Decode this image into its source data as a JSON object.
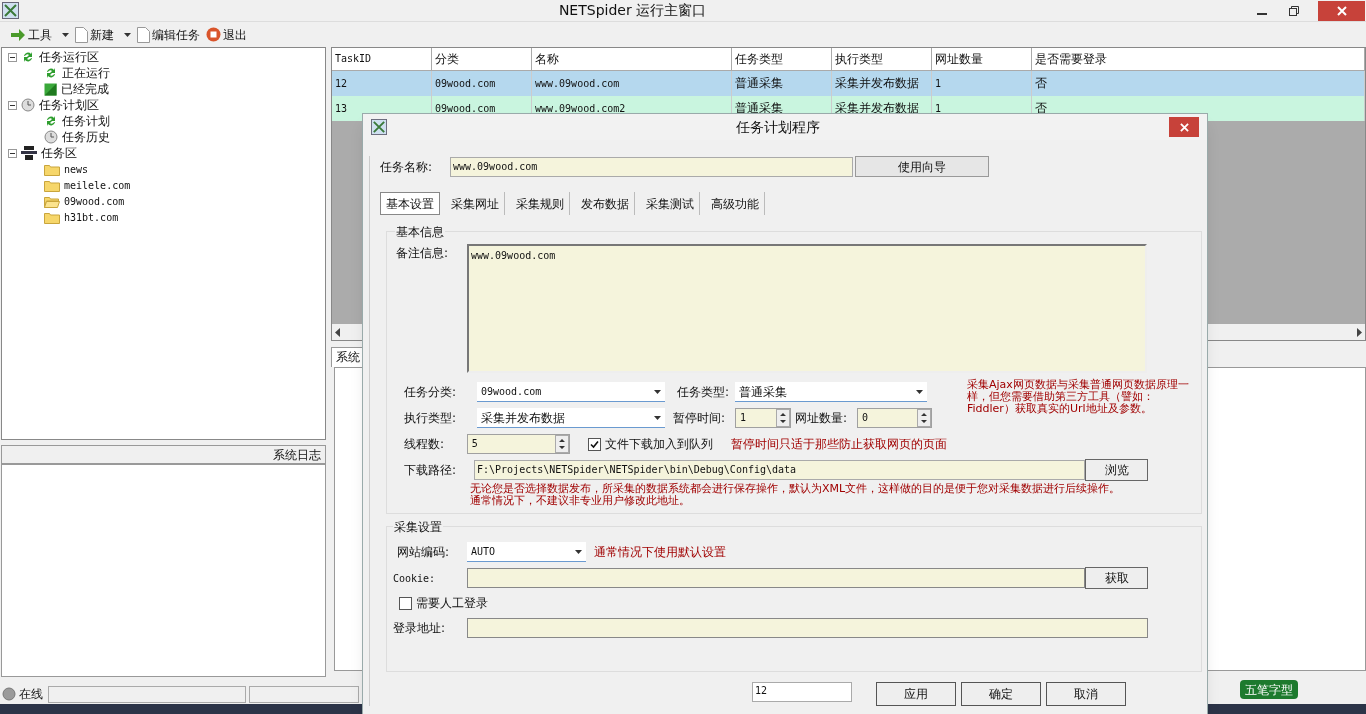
{
  "window": {
    "title": "NETSpider 运行主窗口"
  },
  "toolbar": [
    {
      "label": "工具",
      "kind": "dropdown"
    },
    {
      "label": "新建",
      "kind": "dropdown"
    },
    {
      "label": "编辑任务",
      "kind": "plain"
    },
    {
      "label": "退出",
      "kind": "plain"
    }
  ],
  "tree": [
    {
      "label": "任务运行区",
      "expanded": true,
      "children": [
        {
          "label": "正在运行"
        },
        {
          "label": "已经完成"
        }
      ]
    },
    {
      "label": "任务计划区",
      "expanded": true,
      "children": [
        {
          "label": "任务计划"
        },
        {
          "label": "任务历史"
        }
      ]
    },
    {
      "label": "任务区",
      "expanded": true,
      "children": [
        {
          "label": "news"
        },
        {
          "label": "meilele.com"
        },
        {
          "label": "09wood.com"
        },
        {
          "label": "h31bt.com"
        }
      ]
    }
  ],
  "log_panel": {
    "title": "系统日志"
  },
  "table": {
    "columns": [
      "TaskID",
      "分类",
      "名称",
      "任务类型",
      "执行类型",
      "网址数量",
      "是否需要登录"
    ],
    "rows": [
      {
        "selected": true,
        "cells": [
          "12",
          "09wood.com",
          "www.09wood.com",
          "普通采集",
          "采集并发布数据",
          "1",
          "否"
        ]
      },
      {
        "selected": false,
        "cells": [
          "13",
          "09wood.com",
          "www.09wood.com2",
          "普通采集",
          "采集并发布数据",
          "1",
          "否"
        ]
      }
    ]
  },
  "bottom_tab": "系统",
  "status_bar": {
    "label": "在线"
  },
  "ime": {
    "label": "五笔字型"
  },
  "dialog": {
    "title": "任务计划程序",
    "task_name": {
      "label": "任务名称:",
      "value": "www.09wood.com",
      "button": "使用向导"
    },
    "tabs": [
      {
        "label": "基本设置",
        "selected": true
      },
      {
        "label": "采集网址",
        "selected": false
      },
      {
        "label": "采集规则",
        "selected": false
      },
      {
        "label": "发布数据",
        "selected": false
      },
      {
        "label": "采集测试",
        "selected": false
      },
      {
        "label": "高级功能",
        "selected": false
      }
    ],
    "basic": {
      "title": "基本信息",
      "notes": {
        "label": "备注信息:",
        "value": "www.09wood.com"
      },
      "category": {
        "label": "任务分类:",
        "value": "09wood.com"
      },
      "task_type": {
        "label": "任务类型:",
        "value": "普通采集"
      },
      "exec_type": {
        "label": "执行类型:",
        "value": "采集并发布数据"
      },
      "pause": {
        "label": "暂停时间:",
        "value": "1"
      },
      "url_count": {
        "label": "网址数量:",
        "value": "0"
      },
      "threads": {
        "label": "线程数:",
        "value": "5"
      },
      "queue_download": {
        "label": "文件下载加入到队列",
        "checked": true
      },
      "ajax_note": "采集Ajax网页数据与采集普通网页数据原理一样，但您需要借助第三方工具（譬如：Fiddler）获取真实的Url地址及参数。",
      "pause_note": "暂停时间只适于那些防止获取网页的页面",
      "path": {
        "label": "下载路径:",
        "value": "F:\\Projects\\NETSpider\\NETSpider\\bin\\Debug\\Config\\data",
        "button": "浏览"
      },
      "path_note": "无论您是否选择数据发布，所采集的数据系统都会进行保存操作，默认为XML文件，这样做的目的是便于您对采集数据进行后续操作。通常情况下，不建议非专业用户修改此地址。"
    },
    "collect": {
      "title": "采集设置",
      "encoding": {
        "label": "网站编码:",
        "value": "AUTO",
        "note": "通常情况下使用默认设置"
      },
      "cookie": {
        "label": "Cookie:",
        "button": "获取"
      },
      "manual_login": {
        "label": "需要人工登录",
        "checked": false
      },
      "login_url": {
        "label": "登录地址:"
      }
    },
    "footer": {
      "value": "12",
      "buttons": [
        "应用",
        "确定",
        "取消"
      ]
    }
  }
}
